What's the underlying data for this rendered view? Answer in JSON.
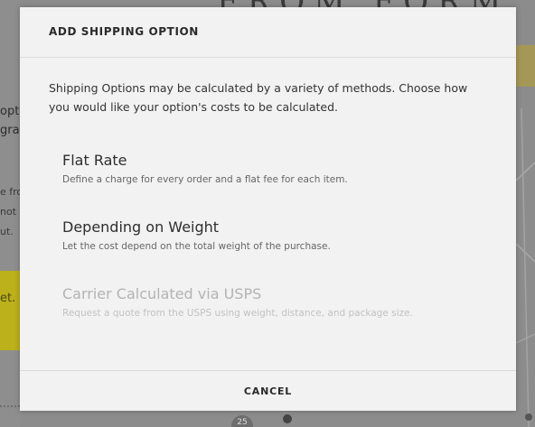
{
  "background": {
    "headline_fragment": "FROM FORM",
    "left_fragments": [
      "opt",
      "gra",
      "e fro",
      "not",
      "ut."
    ],
    "left_yellow_fragment": "et. C",
    "bottom_marker": "25"
  },
  "modal": {
    "title": "ADD SHIPPING OPTION",
    "description": "Shipping Options may be calculated by a variety of methods. Choose how you would like your option's costs to be calculated.",
    "options": [
      {
        "title": "Flat Rate",
        "subtitle": "Define a charge for every order and a flat fee for each item.",
        "enabled": true
      },
      {
        "title": "Depending on Weight",
        "subtitle": "Let the cost depend on the total weight of the purchase.",
        "enabled": true
      },
      {
        "title": "Carrier Calculated via USPS",
        "subtitle": "Request a quote from the USPS using weight, distance, and package size.",
        "enabled": false
      }
    ],
    "cancel_label": "CANCEL"
  },
  "colors": {
    "overlay": "#8c8c8c",
    "modal_bg": "#f2f2f2",
    "accent_yellow": "#bcb01b",
    "disabled_text": "#b3b3b3"
  }
}
